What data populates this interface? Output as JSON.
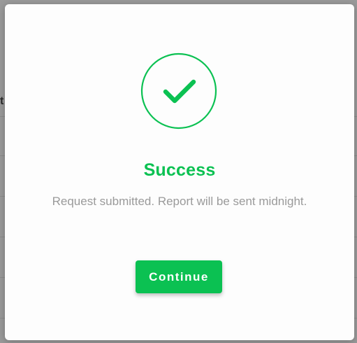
{
  "background": {
    "left_glyph": "t",
    "right_glyph": "\\/"
  },
  "modal": {
    "icon": "check-circle-icon",
    "title": "Success",
    "message": "Request submitted. Report will be sent midnight.",
    "continue_label": "Continue"
  },
  "colors": {
    "accent": "#0bc152",
    "message_text": "#9a9a9a",
    "overlay": "#9a9a9a"
  }
}
